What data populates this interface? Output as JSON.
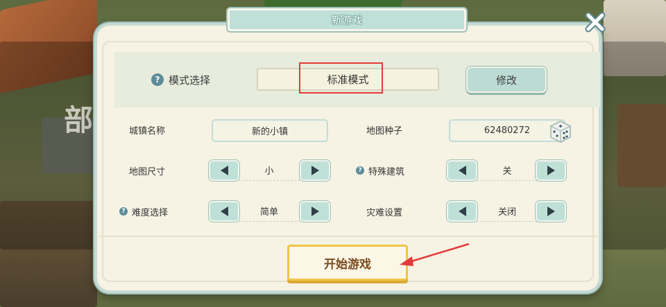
{
  "dialog": {
    "title": "新游戏",
    "mode": {
      "label": "模式选择",
      "value": "标准模式",
      "modify_label": "修改"
    },
    "town_name": {
      "label": "城镇名称",
      "value": "新的小镇"
    },
    "map_seed": {
      "label": "地图种子",
      "value": "62480272"
    },
    "map_size": {
      "label": "地图尺寸",
      "value": "小"
    },
    "special_buildings": {
      "label": "特殊建筑",
      "value": "关"
    },
    "difficulty": {
      "label": "难度选择",
      "value": "简单"
    },
    "disaster": {
      "label": "灾难设置",
      "value": "关闭"
    },
    "start_label": "开始游戏",
    "help_glyph": "?"
  },
  "background": {
    "sign_text": "部"
  },
  "colors": {
    "annotation_red": "#e23a3a",
    "accent_teal": "#bcdcd3",
    "start_border": "#f0c448"
  },
  "icons": [
    "close-icon",
    "help-icon",
    "arrow-left-icon",
    "arrow-right-icon",
    "dice-icon"
  ]
}
